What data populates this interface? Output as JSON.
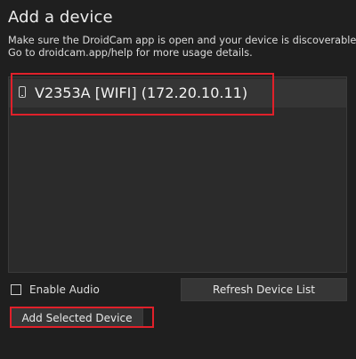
{
  "dialog": {
    "title": "Add a device",
    "instructions": [
      "Make sure the DroidCam app is open and your device is discoverable.",
      "Go to droidcam.app/help for more usage details."
    ]
  },
  "device_list": {
    "items": [
      {
        "icon": "phone-icon",
        "label": "V2353A [WIFI] (172.20.10.11)",
        "selected": true
      }
    ]
  },
  "options": {
    "enable_audio_label": "Enable Audio",
    "enable_audio_checked": false
  },
  "buttons": {
    "refresh_label": "Refresh Device List",
    "add_label": "Add Selected Device"
  },
  "colors": {
    "background": "#1f1f1f",
    "list_background": "#2b2b2b",
    "selected_row": "#353535",
    "button_background": "#363636",
    "highlight": "#e0202a"
  }
}
